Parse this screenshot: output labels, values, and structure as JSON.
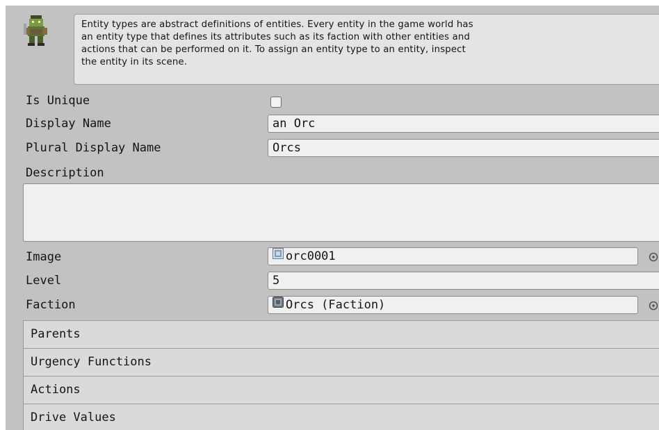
{
  "header": {
    "avatar_icon": "orc-character-icon",
    "help_text": "Entity types are abstract definitions of entities. Every entity in the game world has\nan entity type that defines its attributes such as its faction with other entities and\nactions that can be performed on it. To assign an entity type to an entity, inspect\nthe entity in its scene."
  },
  "fields": {
    "is_unique": {
      "label": "Is Unique",
      "checked": false
    },
    "display_name": {
      "label": "Display Name",
      "value": "an Orc"
    },
    "plural_display_name": {
      "label": "Plural Display Name",
      "value": "Orcs"
    },
    "description": {
      "label": "Description",
      "value": ""
    },
    "image": {
      "label": "Image",
      "value": "orc0001",
      "icon": "texture-icon"
    },
    "level": {
      "label": "Level",
      "value": "5"
    },
    "faction": {
      "label": "Faction",
      "value": "Orcs (Faction)",
      "icon": "faction-asset-icon"
    }
  },
  "sections": [
    {
      "label": "Parents"
    },
    {
      "label": "Urgency Functions"
    },
    {
      "label": "Actions"
    },
    {
      "label": "Drive Values"
    }
  ],
  "colors": {
    "background": "#c2c2c2",
    "field": "#f0f0f0",
    "help_box": "#e4e4e4",
    "section": "#dadada"
  }
}
